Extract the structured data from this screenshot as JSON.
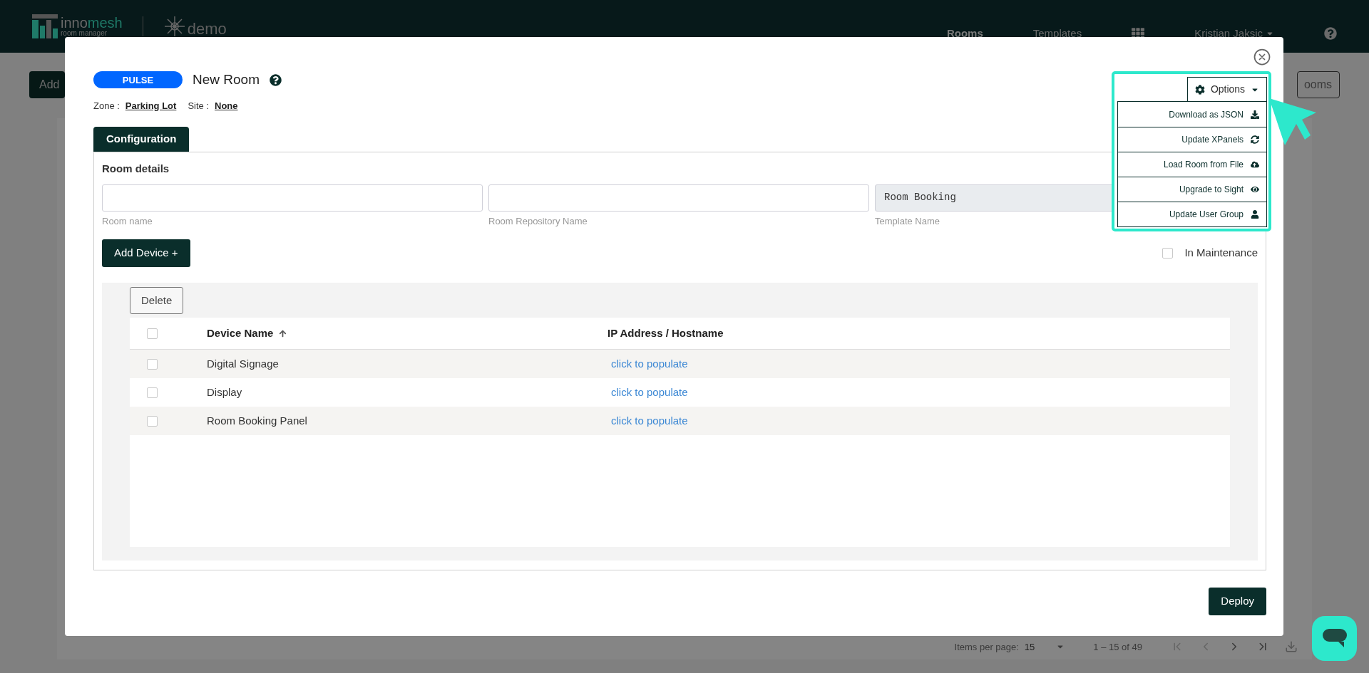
{
  "header": {
    "brand": {
      "part1": "inno",
      "part2": "mesh",
      "subtitle": "room manager"
    },
    "tenant": "demo",
    "nav": [
      {
        "label": "Rooms",
        "selected": true
      },
      {
        "label": "Templates",
        "selected": false
      }
    ],
    "user": "Kristian Jaksic"
  },
  "background": {
    "add_button": "Add",
    "right_button": "ooms",
    "paginator": {
      "items_per_page_label": "Items per page:",
      "items_per_page": "15",
      "range": "1 – 15 of 49"
    }
  },
  "modal": {
    "badge": "PULSE",
    "title": "New Room",
    "zone_label": "Zone :",
    "zone": "Parking Lot",
    "site_label": "Site :",
    "site": "None",
    "tabs": [
      {
        "label": "Configuration",
        "selected": true
      }
    ],
    "section": "Room details",
    "fields": [
      {
        "label": "Room name",
        "disabled": false
      },
      {
        "label": "Room Repository Name",
        "disabled": false
      },
      {
        "label": "Template Name",
        "value": "Room Booking",
        "disabled": true
      }
    ],
    "add_device": "Add Device +",
    "maintenance": {
      "label": "In Maintenance",
      "checked": false
    },
    "delete": "Delete",
    "table": {
      "header_checked": false,
      "columns": [
        {
          "label": "Device Name",
          "sort_ascending": true
        },
        {
          "label": "IP Address / Hostname"
        }
      ],
      "rows": [
        {
          "device": "Digital Signage",
          "ip": "click to populate",
          "checked": false
        },
        {
          "device": "Display",
          "ip": "click to populate",
          "checked": false
        },
        {
          "device": "Room Booking Panel",
          "ip": "click to populate",
          "checked": false
        }
      ]
    },
    "deploy": "Deploy",
    "options": {
      "label": "Options",
      "expanded": true,
      "items": [
        {
          "label": "Download as JSON"
        },
        {
          "label": "Update XPanels"
        },
        {
          "label": "Load Room from File"
        },
        {
          "label": "Upgrade to Sight"
        },
        {
          "label": "Update User Group"
        }
      ]
    }
  }
}
